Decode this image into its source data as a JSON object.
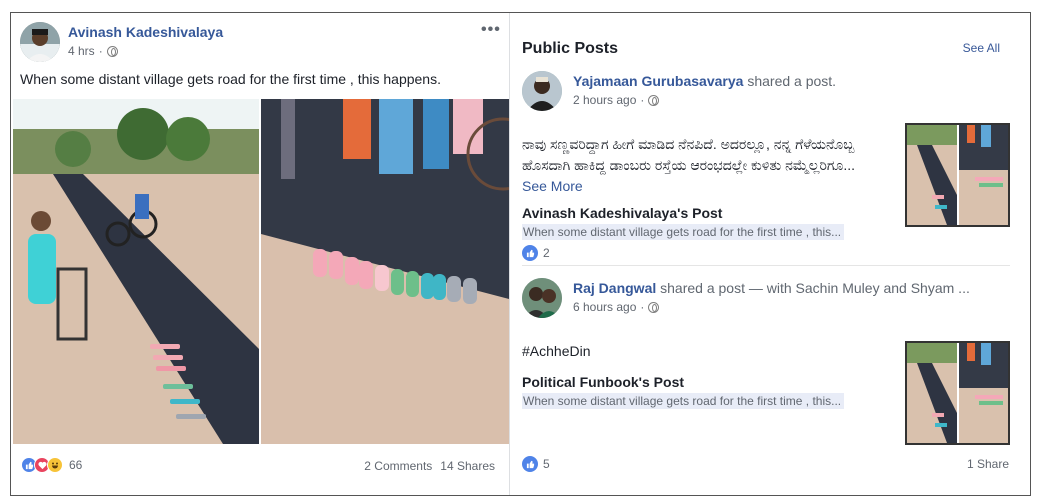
{
  "post": {
    "author": "Avinash Kadeshivalaya",
    "time": "4 hrs",
    "more_label": "•••",
    "text": "When some distant village gets road for the first time , this happens.",
    "reaction_count": "66",
    "comments": "2 Comments",
    "shares": "14 Shares"
  },
  "panel": {
    "title": "Public Posts",
    "see_all": "See All",
    "items": [
      {
        "name": "Yajamaan Gurubasavarya",
        "action": "shared a post.",
        "time": "2 hours ago",
        "body": "ನಾವು ಸಣ್ಣವರಿದ್ದಾಗ ಹೀಗೆ ಮಾಡಿದ ನೆನಪಿದೆ. ಅದರಲ್ಲೂ, ನನ್ನ ಗೆಳೆಯನೊಬ್ಬ ಹೊಸದಾಗಿ ಹಾಕಿದ್ದ ಡಾಂಬರು ರಸ್ತೆಯ ಆರಂಭದಲ್ಲೇ ಕುಳಿತು ನಮ್ಮೆಲ್ಲರಿಗೂ...",
        "see_more": "See More",
        "shared_title": "Avinash Kadeshivalaya's Post",
        "shared_sub": "When some distant village gets road for the first time , this...",
        "likes": "2",
        "share_count": ""
      },
      {
        "name": "Raj Dangwal",
        "action": "shared a post — with Sachin Muley and Shyam ...",
        "time": "6 hours ago",
        "body": "#AchheDin",
        "see_more": "",
        "shared_title": "Political Funbook's Post",
        "shared_sub": "When some distant village gets road for the first time , this...",
        "likes": "5",
        "share_count": "1 Share"
      }
    ]
  },
  "colors": {
    "link": "#365899",
    "like": "#4f83e8",
    "love": "#e9445f",
    "haha": "#f7c338",
    "asphalt": "#2e3442",
    "dirt": "#d7b8a4"
  },
  "icons": [
    "globe-icon",
    "like-icon",
    "love-icon",
    "haha-icon",
    "more-icon"
  ]
}
